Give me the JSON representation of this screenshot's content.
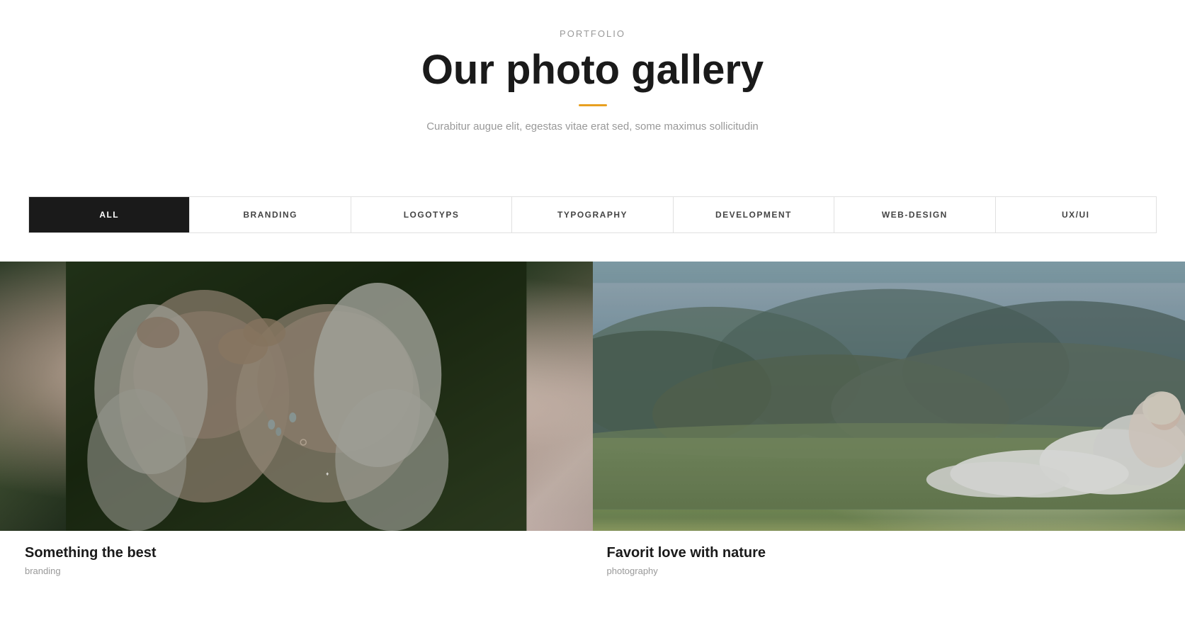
{
  "header": {
    "portfolio_label": "PORTFOLIO",
    "main_title": "Our photo gallery",
    "divider_color": "#e8a020",
    "subtitle": "Curabitur augue elit, egestas vitae erat sed, some maximus sollicitudin"
  },
  "filter_tabs": [
    {
      "id": "all",
      "label": "ALL",
      "active": true
    },
    {
      "id": "branding",
      "label": "BRANDING",
      "active": false
    },
    {
      "id": "logotyps",
      "label": "LOGOTYPS",
      "active": false
    },
    {
      "id": "typography",
      "label": "TYPOGRAPHY",
      "active": false
    },
    {
      "id": "development",
      "label": "DEVELOPMENT",
      "active": false
    },
    {
      "id": "web-design",
      "label": "WEB-DESIGN",
      "active": false
    },
    {
      "id": "ux-ui",
      "label": "UX/UI",
      "active": false
    }
  ],
  "gallery_items": [
    {
      "id": "item-1",
      "title": "Something the best",
      "category": "branding"
    },
    {
      "id": "item-2",
      "title": "Favorit love with nature",
      "category": "photography"
    }
  ]
}
